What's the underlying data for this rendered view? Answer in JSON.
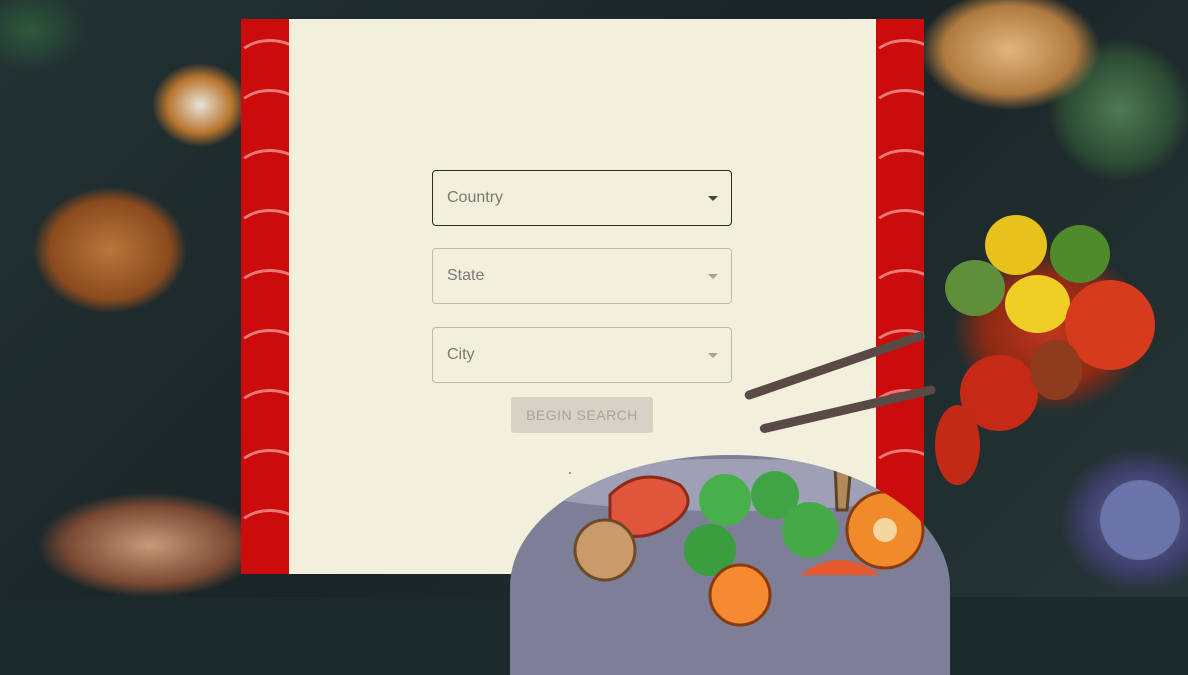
{
  "form": {
    "country_label": "Country",
    "state_label": "State",
    "city_label": "City",
    "search_button": "BEGIN SEARCH"
  },
  "colors": {
    "panel_background": "#f2efdd",
    "pattern_red": "#cc0b0b",
    "pattern_wave": "#e77a78",
    "button_background": "#d6d3c6",
    "button_text": "#a6a398"
  },
  "icons": {
    "dropdown": "triangle-down"
  }
}
